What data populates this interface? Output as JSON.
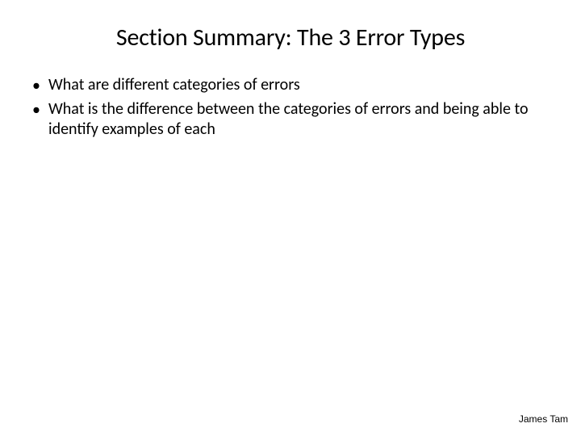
{
  "slide": {
    "title": "Section Summary: The 3 Error Types",
    "bullets": [
      "What are different categories of errors",
      "What is the difference between the categories of errors and being able to identify examples of each"
    ],
    "author": "James Tam"
  }
}
